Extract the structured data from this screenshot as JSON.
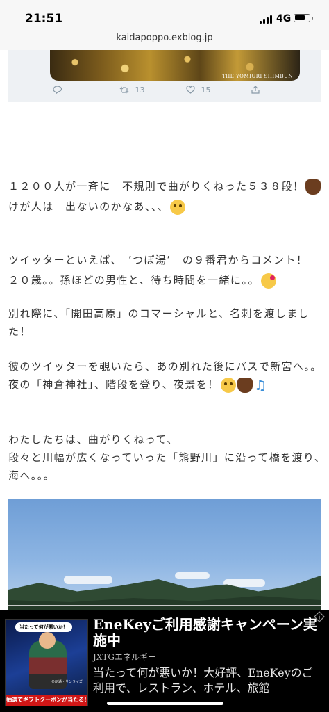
{
  "status_bar": {
    "time": "21:51",
    "network": "4G"
  },
  "browser": {
    "url": "kaidapoppo.exblog.jp"
  },
  "tweet": {
    "photo_credit": "THE YOMIURI SHIMBUN",
    "retweets": "13",
    "likes": "15"
  },
  "article": {
    "p1_line1": "１２００人が一斉に　不規則で曲がりくねった５３８段！",
    "p1_line2": "けが人は　出ないのかなあ、、、",
    "p2_line1": "ツイッターといえば、　’つぼ湯’　の９番君からコメント！",
    "p2_line2": "２０歳。。孫ほどの男性と、待ち時間を一緒に。。",
    "p3_line1": "別れ際に、「開田高原」のコマーシャルと、名刺を渡しまし",
    "p3_line2": "た！",
    "p4_line1": "彼のツイッターを覗いたら、あの別れた後にバスで新宮へ。。",
    "p4_line2": "夜の「神倉神社」、階段を登り、夜景を！",
    "p5_line1": "わたしたちは、曲がりくねって、",
    "p5_line2": "段々と川幅が広くなっていった「熊野川」に沿って橋を渡り、",
    "p5_line3": "海へ。。。"
  },
  "icons": [
    "reply-icon",
    "retweet-icon",
    "like-icon",
    "share-icon",
    "flexed-biceps-emoji",
    "weary-face-emoji",
    "kissing-face-emoji",
    "astonished-face-emoji",
    "musical-notes-emoji",
    "ad-info-icon"
  ],
  "ad": {
    "image_bubble": "当たって何が悪いか！",
    "image_copyright": "©創通・サンライズ",
    "image_banner": "抽選でギフトクーポンが当たる!",
    "title": "EneKeyご利用感謝キャンペーン実施中",
    "sponsor": "JXTGエネルギー",
    "body": "当たって何が悪いか！大好評、EneKeyのご利用で、レストラン、ホテル、旅館"
  },
  "colors": {
    "ad_background": "#000000",
    "ad_banner_red": "#d01616",
    "link_gray": "#8899a6"
  }
}
